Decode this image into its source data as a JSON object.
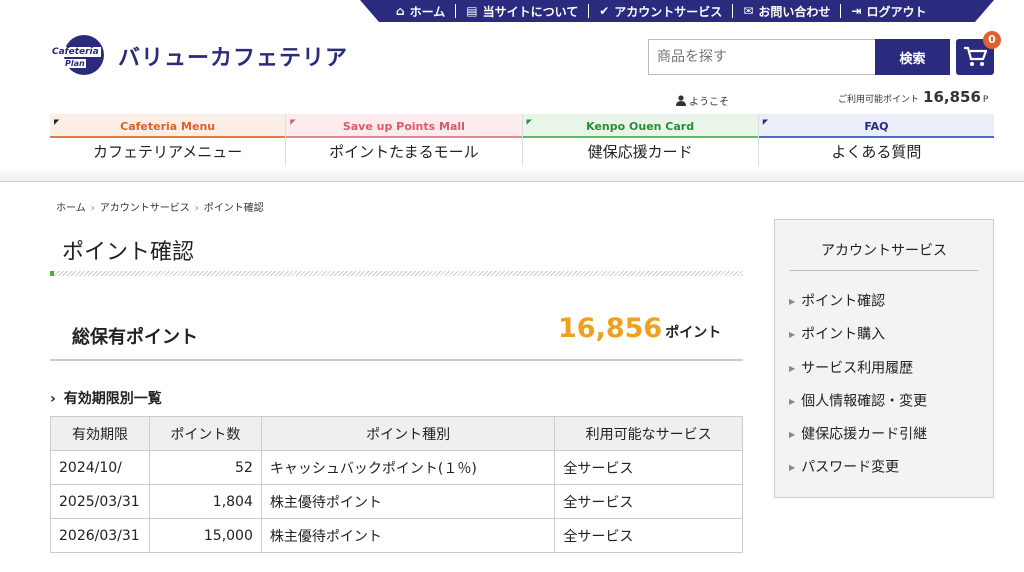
{
  "topnav": [
    {
      "label": "ホーム",
      "icon": "home-icon"
    },
    {
      "label": "当サイトについて",
      "icon": "book-icon"
    },
    {
      "label": "アカウントサービス",
      "icon": "check-circle-icon"
    },
    {
      "label": "お問い合わせ",
      "icon": "envelope-icon"
    },
    {
      "label": "ログアウト",
      "icon": "logout-icon"
    }
  ],
  "logo": {
    "line1": "Cafeteria",
    "line2": "Plan",
    "title": "バリューカフェテリア"
  },
  "search": {
    "placeholder": "商品を探す",
    "button": "検索"
  },
  "cart": {
    "count": "0"
  },
  "user": {
    "welcome": "ようこそ",
    "points_label": "ご利用可能ポイント",
    "points": "16,856",
    "points_unit": "P"
  },
  "nav": [
    {
      "en": "Cafeteria Menu",
      "jp": "カフェテリアメニュー"
    },
    {
      "en": "Save up Points Mall",
      "jp": "ポイントたまるモール"
    },
    {
      "en": "Kenpo Ouen Card",
      "jp": "健保応援カード"
    },
    {
      "en": "FAQ",
      "jp": "よくある質問"
    }
  ],
  "breadcrumb": [
    "ホーム",
    "アカウントサービス",
    "ポイント確認"
  ],
  "page": {
    "title": "ポイント確認",
    "total_label": "総保有ポイント",
    "total_value": "16,856",
    "total_unit": "ポイント",
    "section": "有効期限別一覧"
  },
  "table": {
    "headers": [
      "有効期限",
      "ポイント数",
      "ポイント種別",
      "利用可能なサービス"
    ],
    "rows": [
      [
        "2024/10/",
        "52",
        "キャッシュバックポイント(１％)",
        "全サービス"
      ],
      [
        "2025/03/31",
        "1,804",
        "株主優待ポイント",
        "全サービス"
      ],
      [
        "2026/03/31",
        "15,000",
        "株主優待ポイント",
        "全サービス"
      ]
    ]
  },
  "sidebar": {
    "title": "アカウントサービス",
    "items": [
      "ポイント確認",
      "ポイント購入",
      "サービス利用履歴",
      "個人情報確認・変更",
      "健保応援カード引継",
      "パスワード変更"
    ]
  },
  "colors": {
    "brand": "#2a2b7e",
    "accent": "#f0a020",
    "badge": "#e06030"
  }
}
